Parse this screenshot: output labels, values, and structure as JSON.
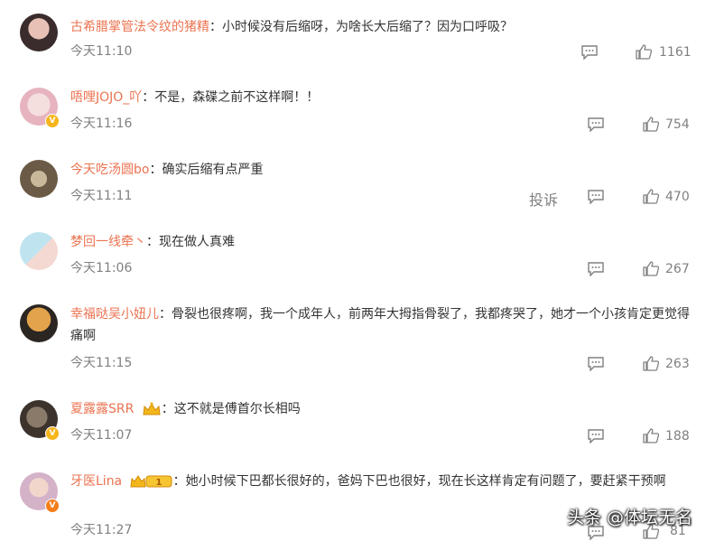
{
  "comments": [
    {
      "username": "古希腊掌管法令纹的猪精",
      "content": "小时候没有后缩呀，为啥长大后缩了？因为口呼吸？",
      "time": "今天11:10",
      "likes": "1161"
    },
    {
      "username": "唔哩JOJO_吖",
      "content": "不是，森碟之前不这样啊！！",
      "time": "今天11:16",
      "likes": "754"
    },
    {
      "username": "今天吃汤圆bo",
      "content": "确实后缩有点严重",
      "time": "今天11:11",
      "likes": "470",
      "report": "投诉"
    },
    {
      "username": "梦回一线牵丶",
      "content": "现在做人真难",
      "time": "今天11:06",
      "likes": "267"
    },
    {
      "username": "幸福哒吴小妞儿",
      "content": "骨裂也很疼啊，我一个成年人，前两年大拇指骨裂了，我都疼哭了，她才一个小孩肯定更觉得痛啊",
      "time": "今天11:15",
      "likes": "263"
    },
    {
      "username": "夏露露SRR",
      "content": "这不就是傅首尔长相吗",
      "time": "今天11:07",
      "likes": "188"
    },
    {
      "username": "牙医Lina",
      "content": "她小时候下巴都长很好的，爸妈下巴也很好，现在长这样肯定有问题了，要赶紧干预啊",
      "time": "今天11:27",
      "likes": "81"
    }
  ],
  "separator": "：",
  "vip_level": "1",
  "watermark": "头条 @体坛无名",
  "colors": {
    "username": "#eb7350",
    "meta": "#808080",
    "text": "#333333"
  }
}
